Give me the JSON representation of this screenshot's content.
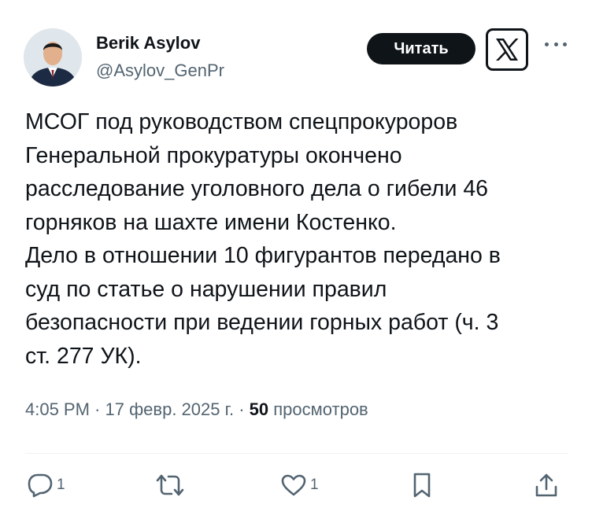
{
  "author": {
    "name": "Berik Asylov",
    "handle": "@Asylov_GenPr"
  },
  "header": {
    "read_button": "Читать",
    "logo_icon": "x-logo-icon",
    "more_icon": "more-icon"
  },
  "tweet": {
    "text": "МСОГ под руководством  спецпрокуроров\nГенеральной прокуратуры окончено\nрасследование уголовного дела о гибели 46\nгорняков на шахте имени Костенко.\nДело в отношении 10 фигурантов передано в\nсуд по статье о нарушении правил\nбезопасности при ведении горных работ (ч. 3\nст. 277 УК)."
  },
  "meta": {
    "time": "4:05 PM",
    "separator": " · ",
    "date": "17 февр. 2025 г.",
    "views_count": "50",
    "views_label": "просмотров"
  },
  "actions": {
    "reply_count": "1",
    "retweet_count": "",
    "like_count": "1"
  },
  "colors": {
    "text": "#0f1419",
    "secondary": "#536471",
    "button_bg": "#0f1419",
    "divider": "#eff3f4"
  }
}
